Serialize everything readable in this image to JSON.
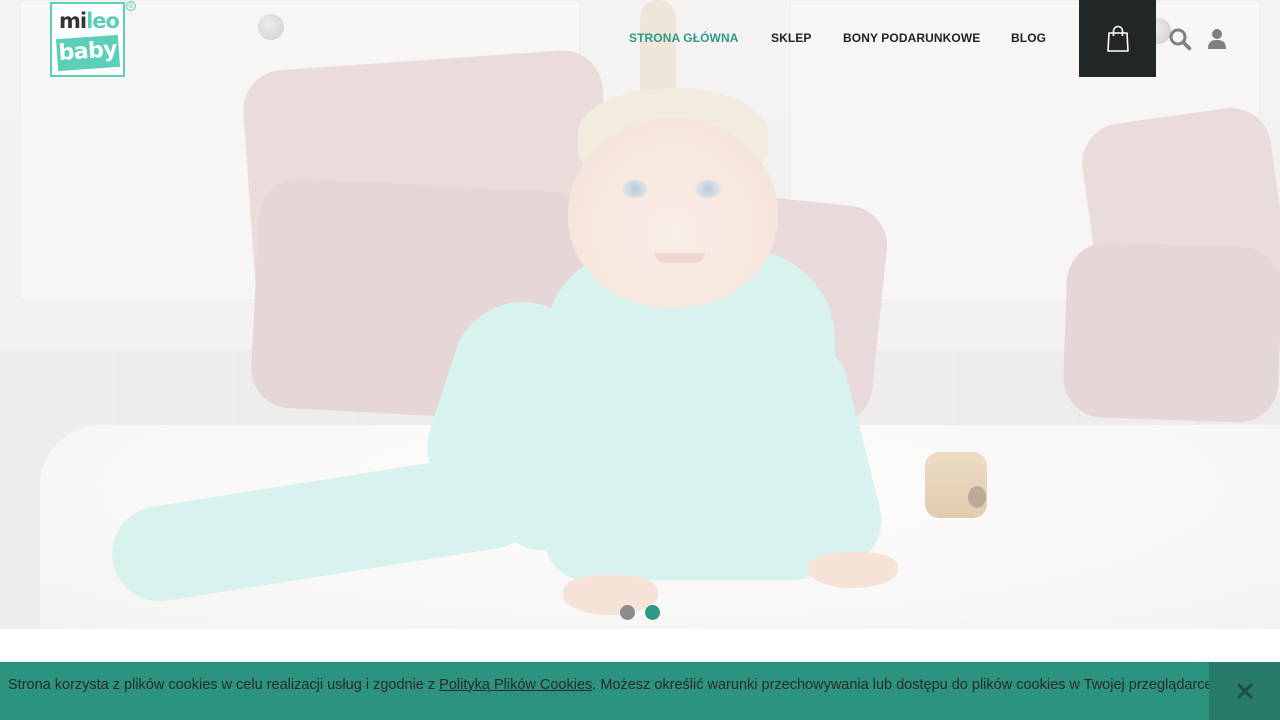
{
  "brand": {
    "logo_line1_a": "mi",
    "logo_line1_b": "leo",
    "logo_line2": "baby",
    "registered": "®",
    "accent_color": "#5bcfb7",
    "primary_color": "#2c9a86"
  },
  "nav": {
    "items": [
      {
        "label": "STRONA GŁÓWNA",
        "active": true
      },
      {
        "label": "SKLEP",
        "active": false
      },
      {
        "label": "BONY PODARUNKOWE",
        "active": false
      },
      {
        "label": "BLOG",
        "active": false
      }
    ]
  },
  "header_icons": {
    "cart": "shopping-bag-icon",
    "search": "search-icon",
    "account": "user-icon"
  },
  "slider": {
    "total_slides": 2,
    "active_slide": 2
  },
  "cookie_bar": {
    "text_before": "Strona korzysta z plików cookies w celu realizacji usług i zgodnie z ",
    "link_text": "Polityką Plików Cookies",
    "text_after": ". Możesz określić warunki przechowywania lub dostępu do plików cookies w Twojej przeglądarce.",
    "close_icon": "close-icon",
    "background_color": "#2c937e"
  }
}
